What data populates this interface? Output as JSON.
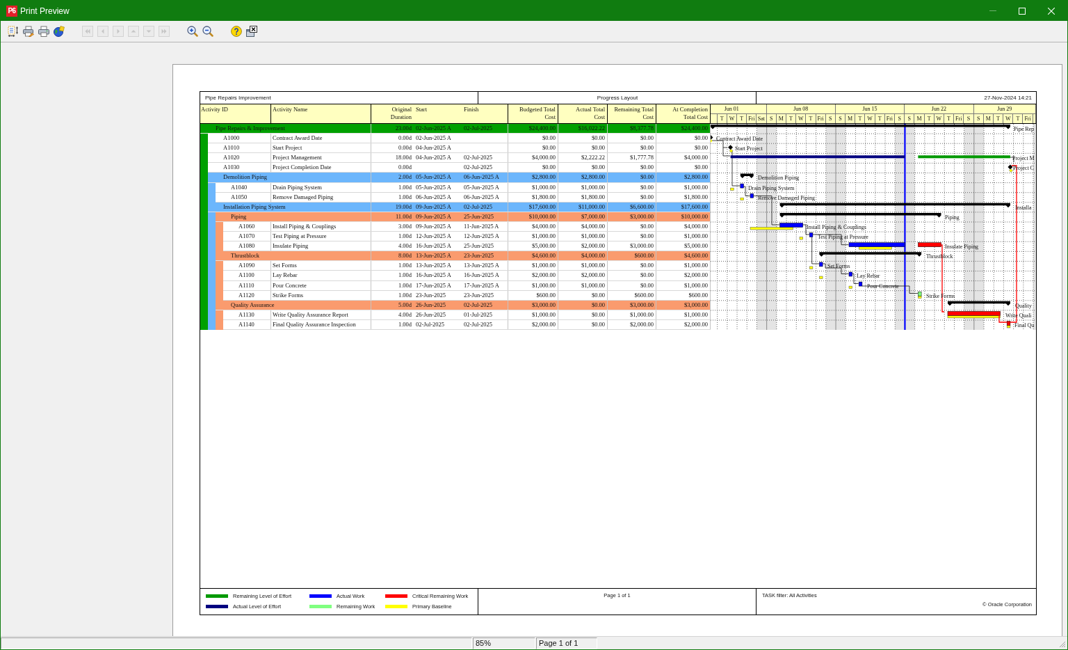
{
  "window": {
    "logo": "P6",
    "title": "Print Preview",
    "controls": [
      {
        "kind": "minimize",
        "disabled": true
      },
      {
        "kind": "maximize",
        "disabled": false
      },
      {
        "kind": "close",
        "disabled": false
      }
    ]
  },
  "toolbar": {
    "groups": [
      {
        "buttons": [
          {
            "kind": "page_setup",
            "disabled": false
          },
          {
            "kind": "print_setup",
            "disabled": false
          },
          {
            "kind": "print",
            "disabled": false
          },
          {
            "kind": "publish",
            "disabled": false
          }
        ]
      },
      {
        "buttons": [
          {
            "kind": "first",
            "disabled": true
          },
          {
            "kind": "previous",
            "disabled": true
          },
          {
            "kind": "next",
            "disabled": true
          },
          {
            "kind": "up",
            "disabled": true
          },
          {
            "kind": "down",
            "disabled": true
          },
          {
            "kind": "last",
            "disabled": true
          }
        ]
      },
      {
        "buttons": [
          {
            "kind": "zoom_in",
            "disabled": false
          },
          {
            "kind": "zoom_out",
            "disabled": false
          }
        ]
      },
      {
        "buttons": [
          {
            "kind": "help",
            "disabled": false
          },
          {
            "kind": "close",
            "disabled": false
          }
        ]
      }
    ]
  },
  "report": {
    "header": {
      "project": "Pipe Repairs Improvement",
      "layout": "Progress Layout",
      "printed": "27-Nov-2024 14:21"
    },
    "columns": [
      "Activity ID",
      "Activity Name",
      "Original Duration",
      "Start",
      "Finish",
      "Budgeted Total Cost",
      "Actual Total Cost",
      "Remaining Total Cost",
      "At Completion Total Cost"
    ],
    "timescale": {
      "weeks": [
        {
          "label": "Jun 01",
          "days": [
            "T",
            "W",
            "T",
            "Fri",
            "Sat"
          ]
        },
        {
          "label": "Jun 08",
          "days": [
            "S",
            "M",
            "T",
            "W",
            "T",
            "Fri",
            "S"
          ]
        },
        {
          "label": "Jun 15",
          "days": [
            "S",
            "M",
            "T",
            "W",
            "T",
            "Fri",
            "S"
          ]
        },
        {
          "label": "Jun 22",
          "days": [
            "S",
            "M",
            "T",
            "W",
            "T",
            "Fri",
            "S"
          ]
        },
        {
          "label": "Jun 29",
          "days": [
            "S",
            "M",
            "T",
            "W",
            "T",
            "Fri"
          ]
        }
      ]
    },
    "rows": [
      {
        "kind": "wbs",
        "name": "Pipe Repairs & Improvement",
        "color": "#00a000",
        "duration": "23.00d",
        "start": "02-Jun-2025 A",
        "finish": "02-Jul-2025",
        "budgeted_cost": "$24,400.00",
        "actual_cost": "$16,022.22",
        "remaining_cost": "$8,377.78",
        "at_completion_cost": "$24,400.00",
        "bar_label": "Pipe Rep",
        "children": [
          {
            "kind": "activity",
            "id": "A1000",
            "name": "Contract Award Date",
            "duration": "0.00d",
            "start": "02-Jun-2025 A",
            "budgeted_cost": "$0.00",
            "actual_cost": "$0.00",
            "remaining_cost": "$0.00",
            "at_completion_cost": "$0.00",
            "bar_label": "Contract Award Date"
          },
          {
            "kind": "activity",
            "id": "A1010",
            "name": "Start Project",
            "duration": "0.00d",
            "start": "04-Jun-2025 A",
            "budgeted_cost": "$0.00",
            "actual_cost": "$0.00",
            "remaining_cost": "$0.00",
            "at_completion_cost": "$0.00",
            "bar_label": "Start Project"
          },
          {
            "kind": "activity",
            "id": "A1020",
            "name": "Project Management",
            "duration": "18.00d",
            "start": "04-Jun-2025 A",
            "finish": "02-Jul-2025",
            "budgeted_cost": "$4,000.00",
            "actual_cost": "$2,222.22",
            "remaining_cost": "$1,777.78",
            "at_completion_cost": "$4,000.00",
            "bar_label": "Project M"
          },
          {
            "kind": "activity",
            "id": "A1030",
            "name": "Project Completion Date",
            "duration": "0.00d",
            "finish": "02-Jul-2025",
            "budgeted_cost": "$0.00",
            "actual_cost": "$0.00",
            "remaining_cost": "$0.00",
            "at_completion_cost": "$0.00",
            "bar_label": "Project C"
          },
          {
            "kind": "wbs",
            "name": "Demolition Piping",
            "color": "#6cb6fc",
            "duration": "2.00d",
            "start": "05-Jun-2025 A",
            "finish": "06-Jun-2025 A",
            "budgeted_cost": "$2,800.00",
            "actual_cost": "$2,800.00",
            "remaining_cost": "$0.00",
            "at_completion_cost": "$2,800.00",
            "bar_label": "Demolition Piping",
            "children": [
              {
                "kind": "activity",
                "id": "A1040",
                "name": "Drain Piping System",
                "duration": "1.00d",
                "start": "05-Jun-2025 A",
                "finish": "05-Jun-2025 A",
                "budgeted_cost": "$1,000.00",
                "actual_cost": "$1,000.00",
                "remaining_cost": "$0.00",
                "at_completion_cost": "$1,000.00",
                "bar_label": "Drain Piping System"
              },
              {
                "kind": "activity",
                "id": "A1050",
                "name": "Remove Damaged Piping",
                "duration": "1.00d",
                "start": "06-Jun-2025 A",
                "finish": "06-Jun-2025 A",
                "budgeted_cost": "$1,800.00",
                "actual_cost": "$1,800.00",
                "remaining_cost": "$0.00",
                "at_completion_cost": "$1,800.00",
                "bar_label": "Remove Damaged Piping"
              }
            ]
          },
          {
            "kind": "wbs",
            "name": "Installation Piping System",
            "color": "#6cb6fc",
            "duration": "19.00d",
            "start": "09-Jun-2025 A",
            "finish": "02-Jul-2025",
            "budgeted_cost": "$17,600.00",
            "actual_cost": "$11,000.00",
            "remaining_cost": "$6,600.00",
            "at_completion_cost": "$17,600.00",
            "bar_label": "Installa",
            "children": [
              {
                "kind": "wbs",
                "name": "Piping",
                "color": "#fa9b6e",
                "duration": "11.00d",
                "start": "09-Jun-2025 A",
                "finish": "25-Jun-2025",
                "budgeted_cost": "$10,000.00",
                "actual_cost": "$7,000.00",
                "remaining_cost": "$3,000.00",
                "at_completion_cost": "$10,000.00",
                "bar_label": "Piping",
                "children": [
                  {
                    "kind": "activity",
                    "id": "A1060",
                    "name": "Install Piping & Couplings",
                    "duration": "3.00d",
                    "start": "09-Jun-2025 A",
                    "finish": "11-Jun-2025 A",
                    "budgeted_cost": "$4,000.00",
                    "actual_cost": "$4,000.00",
                    "remaining_cost": "$0.00",
                    "at_completion_cost": "$4,000.00",
                    "bar_label": "Install Piping & Couplings"
                  },
                  {
                    "kind": "activity",
                    "id": "A1070",
                    "name": "Test Piping at Pressure",
                    "duration": "1.00d",
                    "start": "12-Jun-2025 A",
                    "finish": "12-Jun-2025 A",
                    "budgeted_cost": "$1,000.00",
                    "actual_cost": "$1,000.00",
                    "remaining_cost": "$0.00",
                    "at_completion_cost": "$1,000.00",
                    "bar_label": "Test Piping at Pressure"
                  },
                  {
                    "kind": "activity",
                    "id": "A1080",
                    "name": "Insulate Piping",
                    "duration": "4.00d",
                    "start": "16-Jun-2025 A",
                    "finish": "25-Jun-2025",
                    "budgeted_cost": "$5,000.00",
                    "actual_cost": "$2,000.00",
                    "remaining_cost": "$3,000.00",
                    "at_completion_cost": "$5,000.00",
                    "bar_label": "Insulate Piping"
                  }
                ]
              },
              {
                "kind": "wbs",
                "name": "Thrustblock",
                "color": "#fa9b6e",
                "duration": "8.00d",
                "start": "13-Jun-2025 A",
                "finish": "23-Jun-2025",
                "budgeted_cost": "$4,600.00",
                "actual_cost": "$4,000.00",
                "remaining_cost": "$600.00",
                "at_completion_cost": "$4,600.00",
                "bar_label": "Thrustblock",
                "children": [
                  {
                    "kind": "activity",
                    "id": "A1090",
                    "name": "Set Forms",
                    "duration": "1.00d",
                    "start": "13-Jun-2025 A",
                    "finish": "13-Jun-2025 A",
                    "budgeted_cost": "$1,000.00",
                    "actual_cost": "$1,000.00",
                    "remaining_cost": "$0.00",
                    "at_completion_cost": "$1,000.00",
                    "bar_label": "Set Forms"
                  },
                  {
                    "kind": "activity",
                    "id": "A1100",
                    "name": "Lay Rebar",
                    "duration": "1.00d",
                    "start": "16-Jun-2025 A",
                    "finish": "16-Jun-2025 A",
                    "budgeted_cost": "$2,000.00",
                    "actual_cost": "$2,000.00",
                    "remaining_cost": "$0.00",
                    "at_completion_cost": "$2,000.00",
                    "bar_label": "Lay Rebar"
                  },
                  {
                    "kind": "activity",
                    "id": "A1110",
                    "name": "Pour Concrete",
                    "duration": "1.00d",
                    "start": "17-Jun-2025 A",
                    "finish": "17-Jun-2025 A",
                    "budgeted_cost": "$1,000.00",
                    "actual_cost": "$1,000.00",
                    "remaining_cost": "$0.00",
                    "at_completion_cost": "$1,000.00",
                    "bar_label": "Pour Concrete"
                  },
                  {
                    "kind": "activity",
                    "id": "A1120",
                    "name": "Strike Forms",
                    "duration": "1.00d",
                    "start": "23-Jun-2025",
                    "finish": "23-Jun-2025",
                    "budgeted_cost": "$600.00",
                    "actual_cost": "$0.00",
                    "remaining_cost": "$600.00",
                    "at_completion_cost": "$600.00",
                    "bar_label": "Strike Forms"
                  }
                ]
              },
              {
                "kind": "wbs",
                "name": "Quality Assurance",
                "color": "#fa9b6e",
                "duration": "5.00d",
                "start": "26-Jun-2025",
                "finish": "02-Jul-2025",
                "budgeted_cost": "$3,000.00",
                "actual_cost": "$0.00",
                "remaining_cost": "$3,000.00",
                "at_completion_cost": "$3,000.00",
                "bar_label": "Quality",
                "children": [
                  {
                    "kind": "activity",
                    "id": "A1130",
                    "name": "Write Quality Assurance Report",
                    "duration": "4.00d",
                    "start": "26-Jun-2025",
                    "finish": "01-Jul-2025",
                    "budgeted_cost": "$1,000.00",
                    "actual_cost": "$0.00",
                    "remaining_cost": "$1,000.00",
                    "at_completion_cost": "$1,000.00",
                    "bar_label": "Write Quali"
                  },
                  {
                    "kind": "activity",
                    "id": "A1140",
                    "name": "Final Quality Assurance Inspection",
                    "duration": "1.00d",
                    "start": "02-Jul-2025",
                    "finish": "02-Jul-2025",
                    "budgeted_cost": "$2,000.00",
                    "actual_cost": "$0.00",
                    "remaining_cost": "$2,000.00",
                    "at_completion_cost": "$2,000.00",
                    "bar_label": "Final Qu"
                  }
                ]
              }
            ]
          }
        ]
      }
    ],
    "footer": {
      "legend": [
        {
          "label": "Remaining Level of Effort",
          "color": "#009900"
        },
        {
          "label": "Actual Work",
          "color": "#0000ff"
        },
        {
          "label": "Critical Remaining Work",
          "color": "#ff0000"
        },
        {
          "label": "Actual Level of Effort",
          "color": "#000080"
        },
        {
          "label": "Remaining Work",
          "color": "#80ff80"
        },
        {
          "label": "Primary Baseline",
          "color": "#ffff00"
        }
      ],
      "page": "Page 1 of 1",
      "filter": "TASK filter: All Activities",
      "copyright": "© Oracle Corporation"
    }
  },
  "status_bar": {
    "zoom": "85%",
    "page": "Page 1 of 1"
  }
}
